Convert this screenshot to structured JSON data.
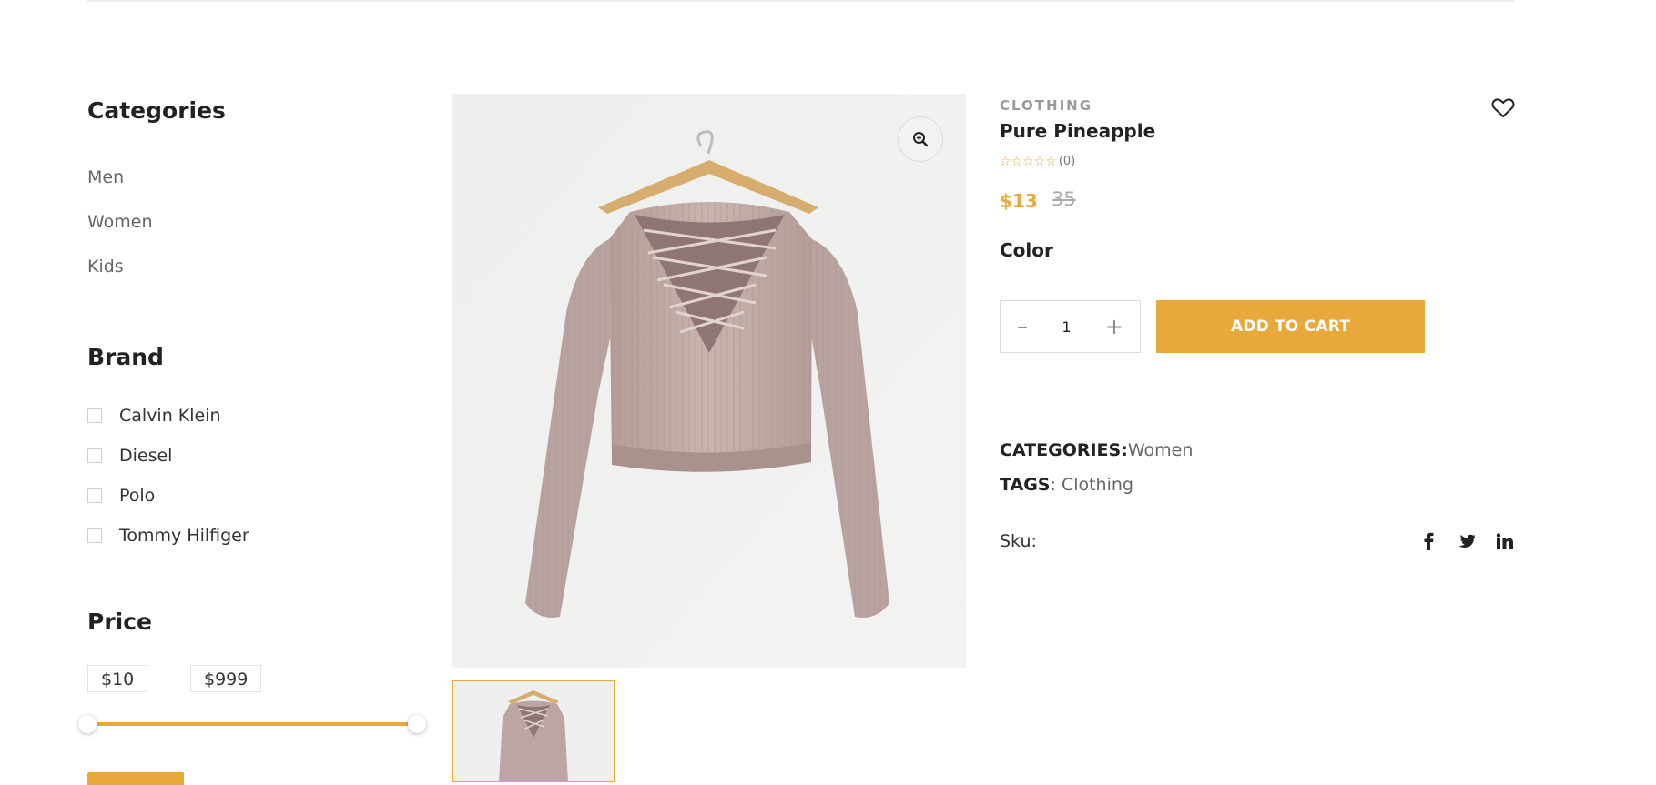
{
  "sidebar": {
    "categories_title": "Categories",
    "categories": [
      "Men",
      "Women",
      "Kids"
    ],
    "brand_title": "Brand",
    "brands": [
      "Calvin Klein",
      "Diesel",
      "Polo",
      "Tommy Hilfiger"
    ],
    "price_title": "Price",
    "price_min": "$10",
    "price_max": "$999"
  },
  "product": {
    "category": "CLOTHING",
    "title": "Pure Pineapple",
    "rating": 0,
    "review_count": "(0)",
    "price": "$13",
    "old_price": "35",
    "color_label": "Color",
    "quantity": "1",
    "add_to_cart": "ADD TO CART",
    "categories_label": "CATEGORIES",
    "categories_value": "Women",
    "tags_label": "TAGS",
    "tags_value": "Clothing",
    "sku_label": "Sku:"
  },
  "icons": {
    "zoom": "zoom-in-icon",
    "wishlist": "heart-icon",
    "social": [
      "facebook-icon",
      "twitter-icon",
      "linkedin-icon"
    ],
    "qty_minus": "–",
    "qty_plus": "+"
  },
  "colors": {
    "accent": "#e8a93a",
    "text": "#222222",
    "muted": "#666666"
  }
}
